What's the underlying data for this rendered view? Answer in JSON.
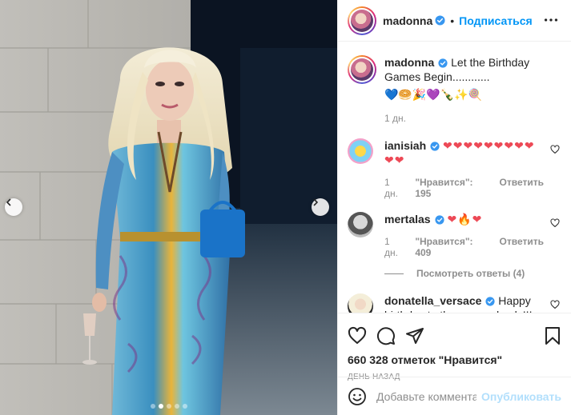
{
  "post": {
    "author": "madonna",
    "follow_label": "Подписаться",
    "header_separator": "•",
    "caption": "Let the Birthday Games Begin............",
    "caption_emojis": "💙🥯🎉💜🍾✨🍭",
    "caption_time": "1 дн.",
    "likes": "660 328 отметок \"Нравится\"",
    "timestamp": "День назад"
  },
  "comments": [
    {
      "user": "ianisiah",
      "text": "❤❤❤❤❤❤❤❤❤❤❤",
      "time": "1 дн.",
      "likes": "\"Нравится\": 195",
      "reply": "Ответить"
    },
    {
      "user": "mertalas",
      "text": "❤🔥❤",
      "time": "1 дн.",
      "likes": "\"Нравится\": 409",
      "reply": "Ответить",
      "view_replies": "Посмотреть ответы (4)"
    },
    {
      "user": "donatella_versace",
      "text": "Happy birthday to the one and only!!! You look AMAZING!!!! 💥💥💥"
    }
  ],
  "add_comment": {
    "placeholder": "Добавьте комментарий...",
    "publish_label": "Опубликовать"
  },
  "icons": {
    "like": "heart-icon",
    "comment": "comment-icon",
    "share": "paper-plane-icon",
    "save": "bookmark-icon",
    "more": "more-dots-icon",
    "emoji": "smiley-icon",
    "prev": "chevron-left-icon",
    "next": "chevron-right-icon",
    "verified": "verified-badge-icon"
  },
  "colors": {
    "accent": "#0095f6",
    "publish_disabled": "#b2dffc",
    "heart": "#ed4956",
    "verified": "#3897f0",
    "muted": "#8e8e8e"
  },
  "carousel": {
    "slides": 5,
    "active_slide": 1
  }
}
